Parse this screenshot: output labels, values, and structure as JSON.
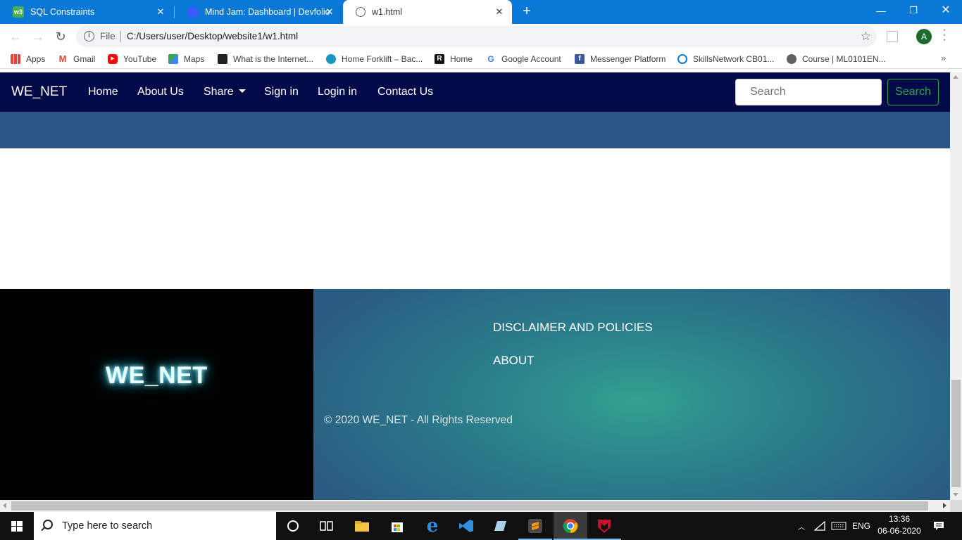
{
  "browser": {
    "tabs": [
      {
        "title": "SQL Constraints",
        "favicon": "w3schools-icon",
        "active": false
      },
      {
        "title": "Mind Jam: Dashboard | Devfolio",
        "favicon": "devfolio-icon",
        "active": false
      },
      {
        "title": "w1.html",
        "favicon": "globe-icon",
        "active": true
      }
    ],
    "address": {
      "scheme_label": "File",
      "url": "C:/Users/user/Desktop/website1/w1.html"
    },
    "profile_initial": "A",
    "bookmarks": [
      {
        "label": "Apps",
        "icon": "apps-grid-icon"
      },
      {
        "label": "Gmail",
        "icon": "gmail-icon"
      },
      {
        "label": "YouTube",
        "icon": "youtube-icon"
      },
      {
        "label": "Maps",
        "icon": "maps-icon"
      },
      {
        "label": "What is the Internet...",
        "icon": "bookmark-icon"
      },
      {
        "label": "Home Forklift – Bac...",
        "icon": "salesforce-icon"
      },
      {
        "label": "Home",
        "icon": "r-icon"
      },
      {
        "label": "Google Account",
        "icon": "google-icon"
      },
      {
        "label": "Messenger Platform",
        "icon": "facebook-icon"
      },
      {
        "label": "SkillsNetwork CB01...",
        "icon": "skillsnetwork-icon"
      },
      {
        "label": "Course | ML0101EN...",
        "icon": "globe-icon"
      }
    ]
  },
  "site": {
    "brand": "WE_NET",
    "nav": [
      {
        "label": "Home"
      },
      {
        "label": "About Us"
      },
      {
        "label": "Share",
        "dropdown": true
      },
      {
        "label": "Sign in"
      },
      {
        "label": "Login in"
      },
      {
        "label": "Contact Us"
      }
    ],
    "search": {
      "placeholder": "Search",
      "button_label": "Search"
    },
    "footer": {
      "logo_text": "WE_NET",
      "links": [
        {
          "label": "DISCLAIMER AND POLICIES"
        },
        {
          "label": "ABOUT"
        }
      ],
      "copyright": "© 2020 WE_NET - All Rights Reserved"
    },
    "colors": {
      "navbar": "#020a4a",
      "hero": "#2b5584",
      "search_button": "#28a745",
      "logo_glow": "#31c8de"
    }
  },
  "taskbar": {
    "search_placeholder": "Type here to search",
    "apps": [
      "cortana-icon",
      "task-view-icon",
      "file-explorer-icon",
      "store-icon",
      "edge-icon",
      "vscode-icon",
      "notes-icon",
      "sublime-text-icon",
      "chrome-icon",
      "mcafee-icon"
    ],
    "language": "ENG",
    "time": "13:36",
    "date": "06-06-2020"
  }
}
